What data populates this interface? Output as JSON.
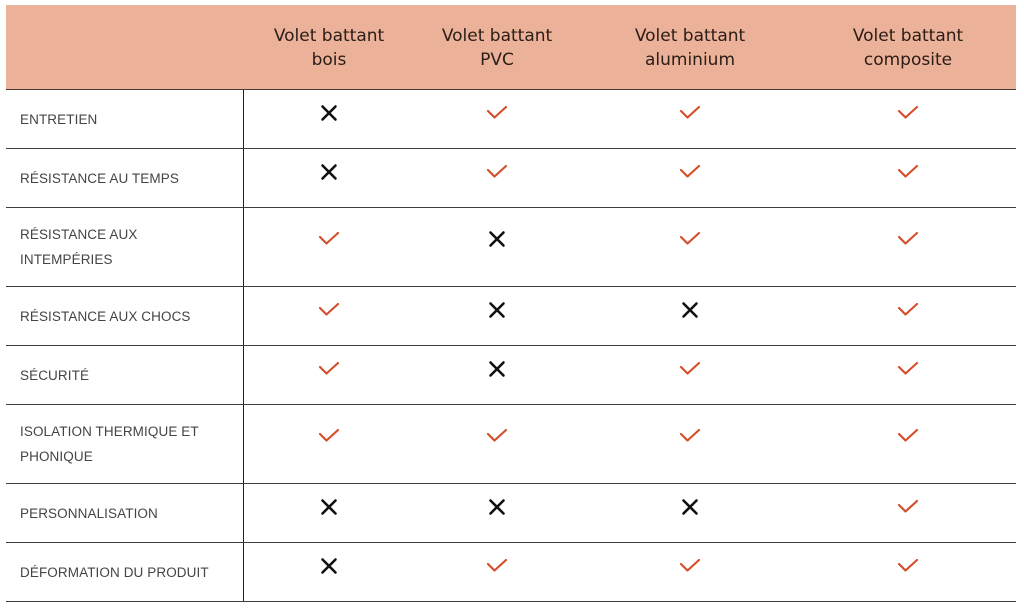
{
  "table": {
    "columns": [
      "",
      "Volet battant\nbois",
      "Volet battant\nPVC",
      "Volet battant\naluminium",
      "Volet battant\ncomposite"
    ],
    "column_labels": [
      {
        "line1": "",
        "line2": ""
      },
      {
        "line1": "Volet battant",
        "line2": "bois"
      },
      {
        "line1": "Volet battant",
        "line2": "PVC"
      },
      {
        "line1": "Volet battant",
        "line2": "aluminium"
      },
      {
        "line1": "Volet battant",
        "line2": "composite"
      }
    ],
    "rows": [
      {
        "label": "ENTRETIEN",
        "values": [
          "cross-icon",
          "check-icon",
          "check-icon",
          "check-icon"
        ]
      },
      {
        "label": "RÉSISTANCE AU TEMPS",
        "values": [
          "cross-icon",
          "check-icon",
          "check-icon",
          "check-icon"
        ]
      },
      {
        "label": "RÉSISTANCE AUX INTEMPÉRIES",
        "values": [
          "check-icon",
          "cross-icon",
          "check-icon",
          "check-icon"
        ]
      },
      {
        "label": "RÉSISTANCE AUX CHOCS",
        "values": [
          "check-icon",
          "cross-icon",
          "cross-icon",
          "check-icon"
        ]
      },
      {
        "label": "SÉCURITÉ",
        "values": [
          "check-icon",
          "cross-icon",
          "check-icon",
          "check-icon"
        ]
      },
      {
        "label": "ISOLATION THERMIQUE ET PHONIQUE",
        "values": [
          "check-icon",
          "check-icon",
          "check-icon",
          "check-icon"
        ]
      },
      {
        "label": "PERSONNALISATION",
        "values": [
          "cross-icon",
          "cross-icon",
          "cross-icon",
          "check-icon"
        ]
      },
      {
        "label": "DÉFORMATION DU PRODUIT",
        "values": [
          "cross-icon",
          "check-icon",
          "check-icon",
          "check-icon"
        ]
      }
    ]
  },
  "colors": {
    "header_bg": "#ebb299",
    "check": "#d4502c",
    "cross": "#111111"
  }
}
